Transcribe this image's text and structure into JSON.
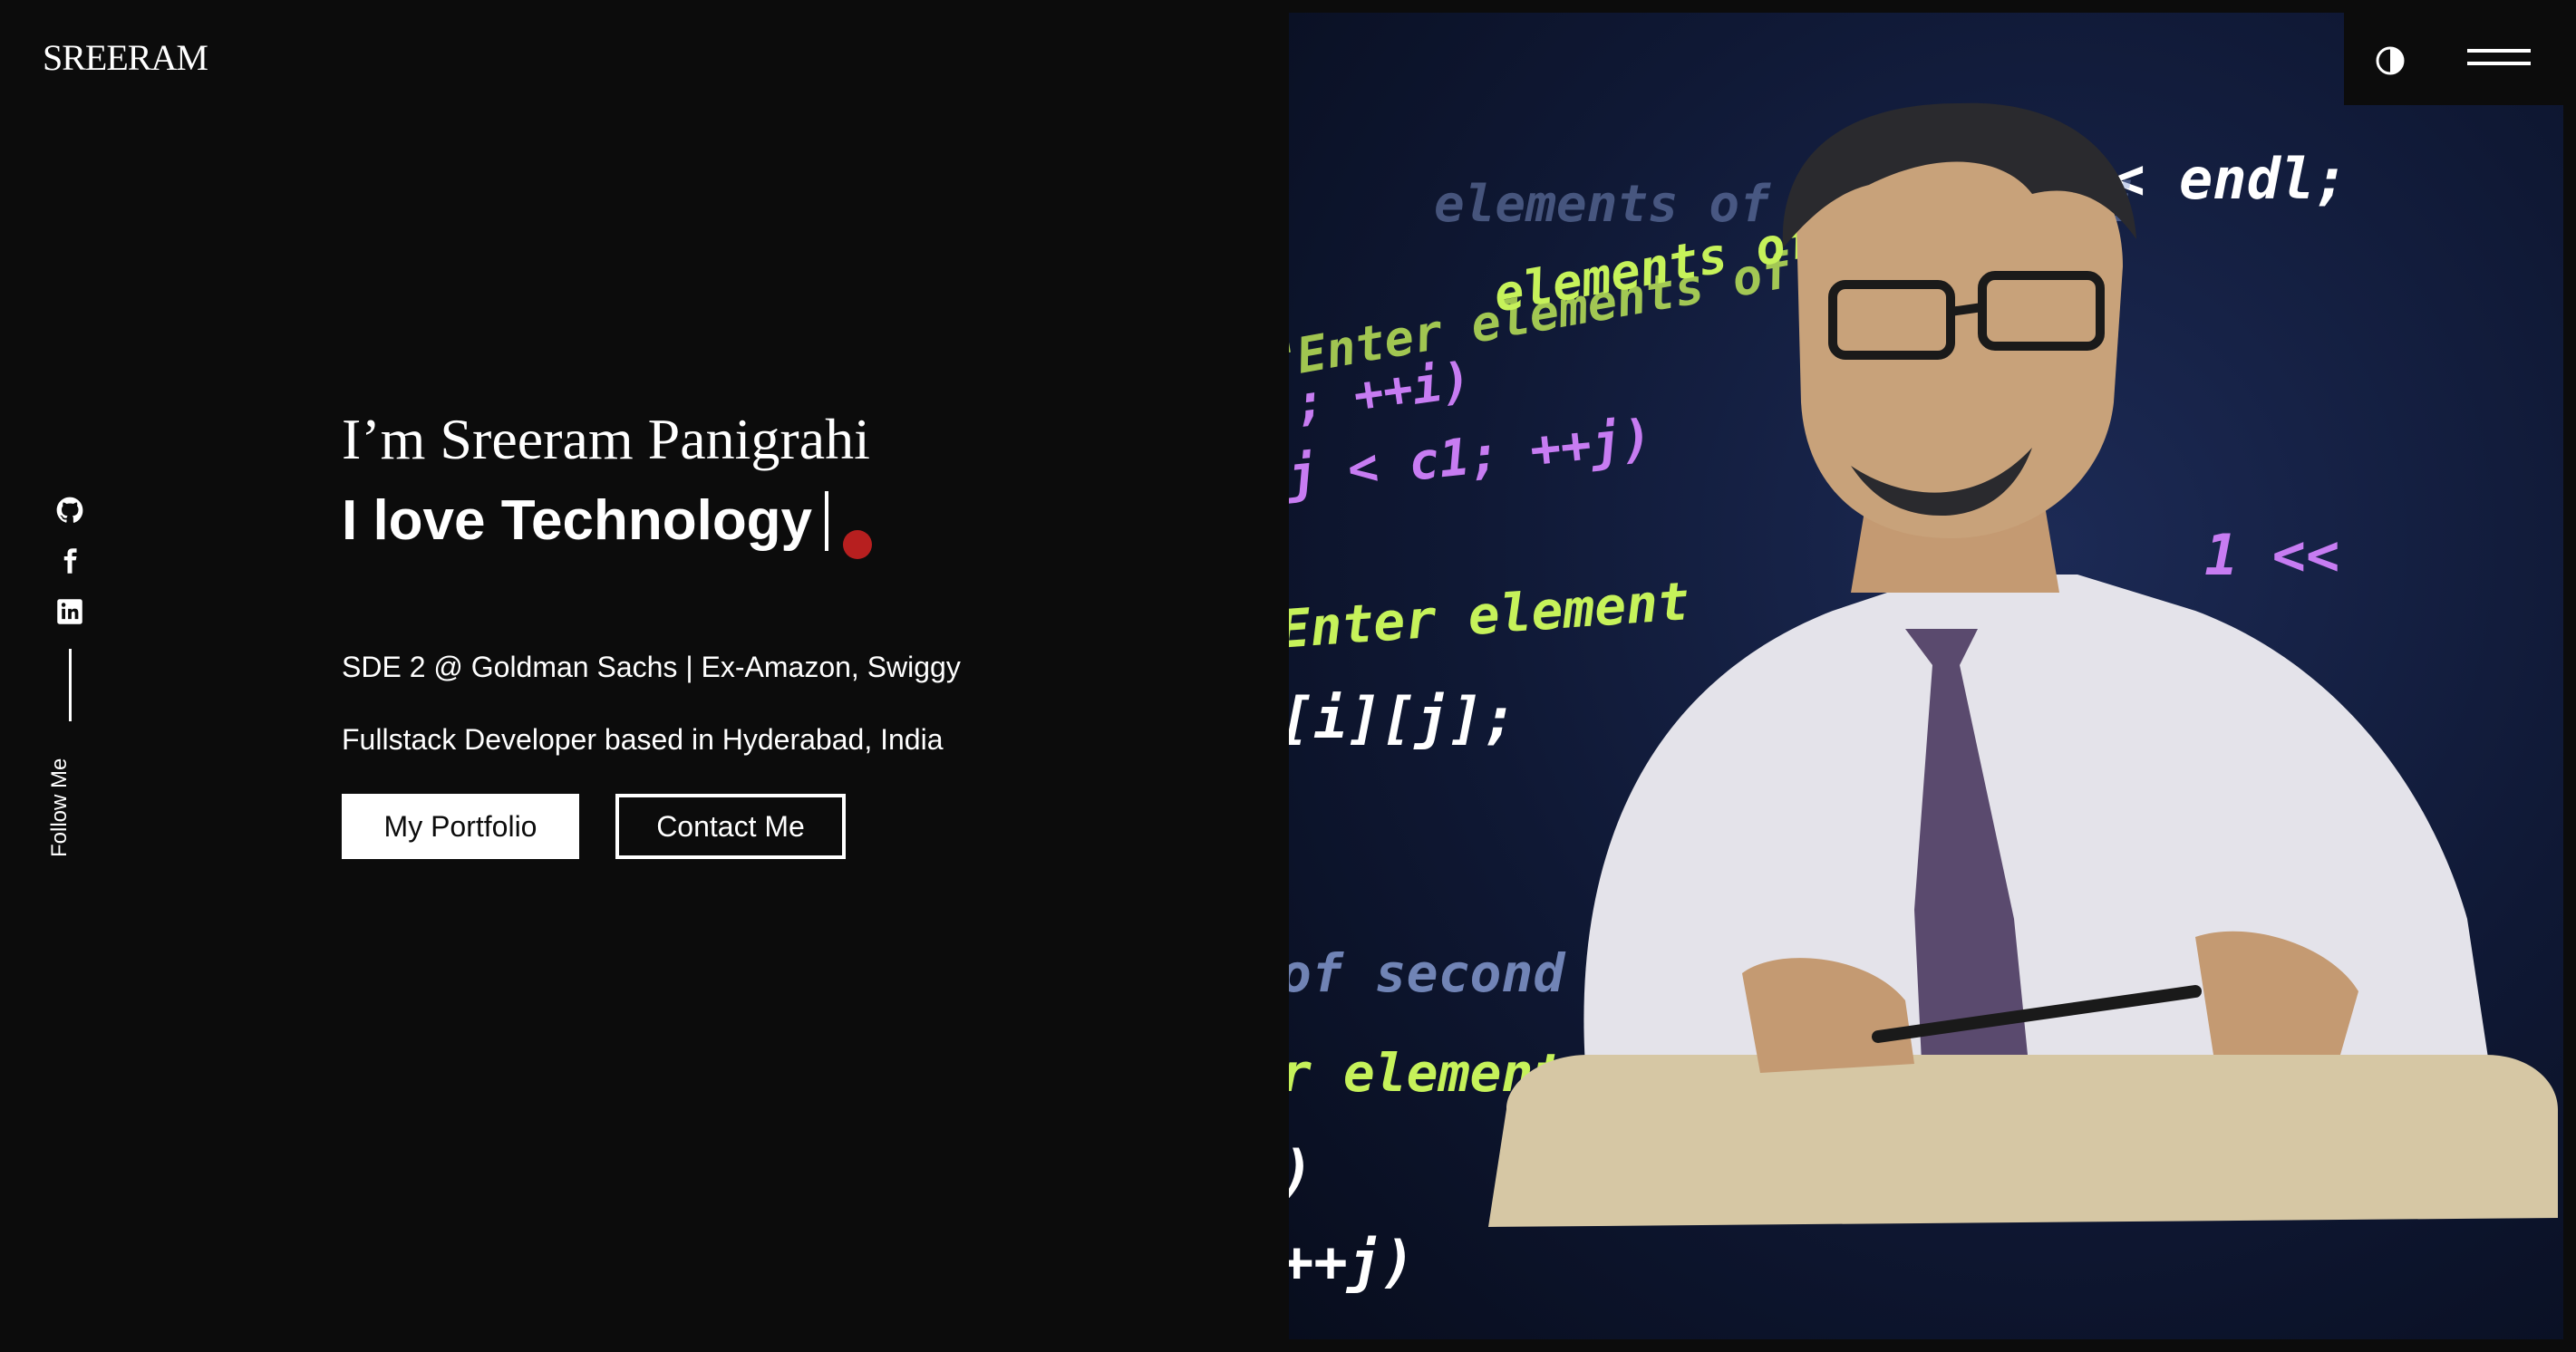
{
  "header": {
    "logo": "SREERAM",
    "theme_toggle_icon": "contrast-icon",
    "menu_icon": "hamburger-menu-icon"
  },
  "social": {
    "items": [
      {
        "name": "GitHub",
        "icon": "github-icon"
      },
      {
        "name": "Facebook",
        "icon": "facebook-icon"
      },
      {
        "name": "LinkedIn",
        "icon": "linkedin-icon"
      }
    ],
    "follow_label": "Follow Me"
  },
  "hero": {
    "greeting": "I’m Sreeram Panigrahi",
    "tagline": "I love Technology",
    "role_line": "SDE 2 @ Goldman Sachs | Ex-Amazon, Swiggy",
    "location_line": "Fullstack Developer based in Hyderabad, India",
    "primary_button": "My Portfolio",
    "secondary_button": "Contact Me"
  },
  "image": {
    "code_lines": [
      "<< endl;",
      "elements of",
      "\"Enter elements of",
      "; ++i)",
      "j < c1; ++j)",
      "1 <<",
      "Enter element",
      "[i][j];",
      "of second",
      "r elements",
      ")",
      "++j)",
      "elements of first matri"
    ]
  },
  "colors": {
    "background": "#0c0c0c",
    "accent_dot": "#b71f1f",
    "code_green": "#c6f25a",
    "code_purple": "#c77cf2"
  }
}
